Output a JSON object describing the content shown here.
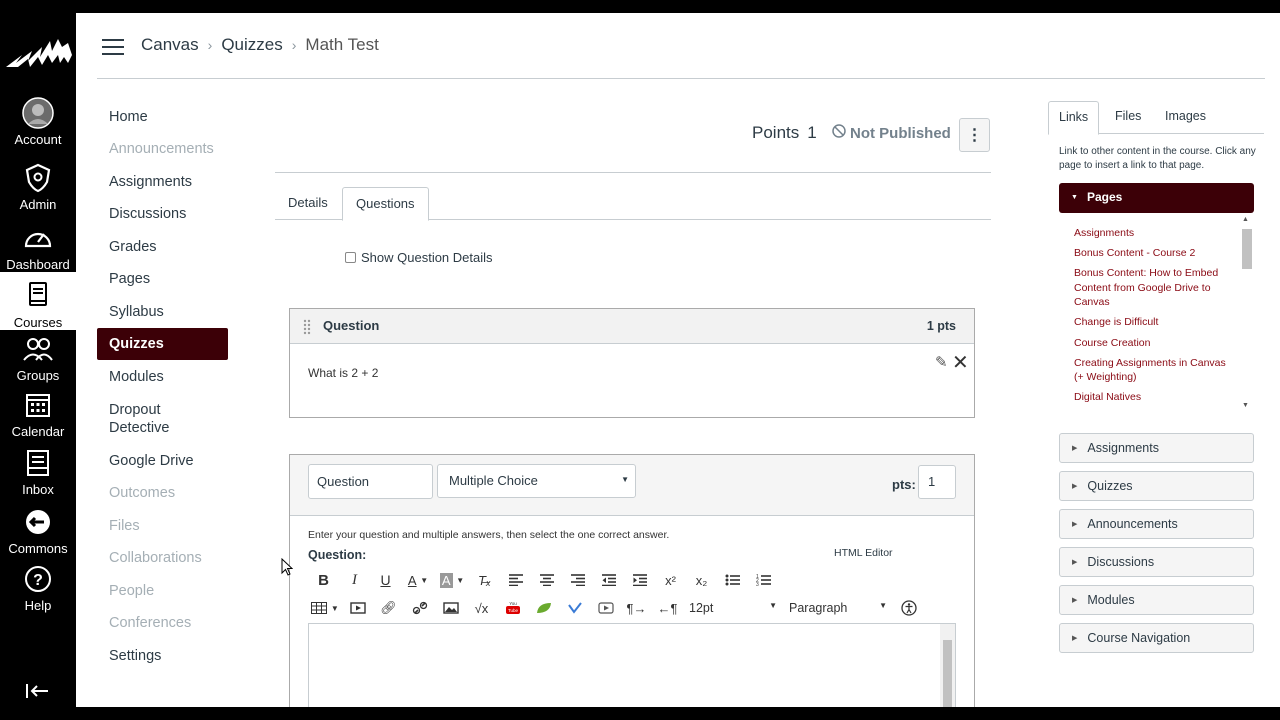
{
  "global_nav": {
    "items": [
      {
        "label": "Account",
        "icon": "avatar-icon"
      },
      {
        "label": "Admin",
        "icon": "shield-icon"
      },
      {
        "label": "Dashboard",
        "icon": "speedometer-icon"
      },
      {
        "label": "Courses",
        "icon": "book-icon"
      },
      {
        "label": "Groups",
        "icon": "people-icon"
      },
      {
        "label": "Calendar",
        "icon": "calendar-icon"
      },
      {
        "label": "Inbox",
        "icon": "inbox-icon"
      },
      {
        "label": "Commons",
        "icon": "commons-icon"
      },
      {
        "label": "Help",
        "icon": "help-icon"
      }
    ],
    "active": "Courses"
  },
  "breadcrumb": {
    "items": [
      "Canvas",
      "Quizzes",
      "Math Test"
    ]
  },
  "course_nav": {
    "items": [
      {
        "label": "Home",
        "state": "enabled"
      },
      {
        "label": "Announcements",
        "state": "disabled"
      },
      {
        "label": "Assignments",
        "state": "enabled"
      },
      {
        "label": "Discussions",
        "state": "enabled"
      },
      {
        "label": "Grades",
        "state": "enabled"
      },
      {
        "label": "Pages",
        "state": "enabled"
      },
      {
        "label": "Syllabus",
        "state": "enabled"
      },
      {
        "label": "Quizzes",
        "state": "active"
      },
      {
        "label": "Modules",
        "state": "enabled"
      },
      {
        "label": "Dropout Detective",
        "state": "enabled"
      },
      {
        "label": "Google Drive",
        "state": "enabled"
      },
      {
        "label": "Outcomes",
        "state": "disabled"
      },
      {
        "label": "Files",
        "state": "disabled"
      },
      {
        "label": "Collaborations",
        "state": "disabled"
      },
      {
        "label": "People",
        "state": "disabled"
      },
      {
        "label": "Conferences",
        "state": "disabled"
      },
      {
        "label": "Settings",
        "state": "enabled"
      }
    ]
  },
  "quiz_header": {
    "points_label": "Points",
    "points_value": "1",
    "publish_status": "Not Published"
  },
  "tabs": [
    "Details",
    "Questions"
  ],
  "active_tab": "Questions",
  "show_details_label": "Show Question Details",
  "question_card": {
    "title": "Question",
    "points": "1 pts",
    "text": "What is 2 + 2"
  },
  "question_editor": {
    "name_value": "Question",
    "type_value": "Multiple Choice",
    "pts_label": "pts:",
    "pts_value": "1",
    "instructions": "Enter your question and multiple answers, then select the one correct answer.",
    "question_label": "Question:",
    "html_editor_link": "HTML Editor",
    "font_size": "12pt",
    "block_format": "Paragraph"
  },
  "right_sidebar": {
    "tabs": [
      "Links",
      "Files",
      "Images"
    ],
    "active_tab": "Links",
    "help_text": "Link to other content in the course. Click any page to insert a link to that page.",
    "pages_header": "Pages",
    "pages": [
      "Assignments",
      "Bonus Content - Course 2",
      "Bonus Content: How to Embed Content from Google Drive to Canvas",
      "Change is Difficult",
      "Course Creation",
      "Creating Assignments in Canvas (+ Weighting)",
      "Digital Natives"
    ],
    "sections": [
      "Assignments",
      "Quizzes",
      "Announcements",
      "Discussions",
      "Modules",
      "Course Navigation"
    ]
  },
  "colors": {
    "brand": "#3c0007",
    "link": "#8a0a14",
    "nav_bg": "#000000"
  }
}
